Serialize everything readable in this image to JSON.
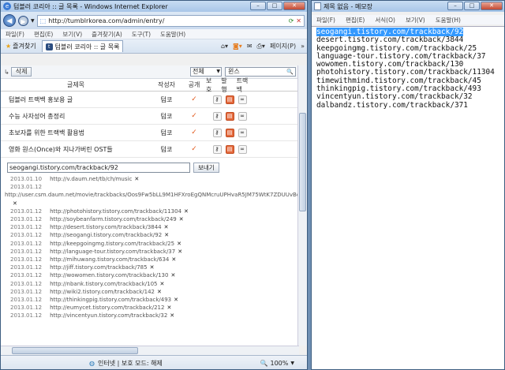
{
  "ie": {
    "title": "텀블러 코리아 :: 글 목록 - Windows Internet Explorer",
    "url": "http://tumblrkorea.com/admin/entry/",
    "menu": [
      "파일(F)",
      "편집(E)",
      "보기(V)",
      "즐겨찾기(A)",
      "도구(T)",
      "도움말(H)"
    ],
    "favorites_label": "즐겨찾기",
    "tab_label": "텀블러 코리아 :: 글 목록",
    "page_menu": "페이지(P)",
    "status_zone": "인터넷 | 보호 모드: 해제",
    "zoom": "100%"
  },
  "admin": {
    "delete_label": "삭제",
    "filter_select": "전체",
    "search_value": "윈스",
    "columns": {
      "title": "글제목",
      "author": "작성자",
      "public": "공개",
      "actions": [
        "보호",
        "발행",
        "트랙백"
      ]
    },
    "rows": [
      {
        "title": "텀블러 트랙백 홍보용 글",
        "author": "텀코"
      },
      {
        "title": "수능 사자성어 총정리",
        "author": "텀코"
      },
      {
        "title": "초보자를 위한 트랙백 활용법",
        "author": "텀코"
      },
      {
        "title": "영화 원스(Once)와 지나가버린 OST들",
        "author": "텀코"
      }
    ],
    "trackback_input": "seogangi.tistory.com/trackback/92",
    "send_label": "보내기",
    "trackbacks": [
      {
        "date": "2013.01.10",
        "url": "http://v.daum.net/tb/ch/music",
        "x": true
      },
      {
        "date": "2013.01.12",
        "url": "",
        "x": false
      },
      {
        "date": "",
        "url": "http://user.csm.daum.net/movie/trackbacks/Oos9Fw5bLL9M1HFXroEgQNMcruUPHvaR5JM75WtK7ZDUUvBdCwEE6cCa",
        "x": false,
        "full": true
      },
      {
        "date": "",
        "url": "",
        "x": true
      },
      {
        "date": "2013.01.12",
        "url": "http://photohistory.tistory.com/trackback/11304",
        "x": true
      },
      {
        "date": "2013.01.12",
        "url": "http://soybeanfarm.tistory.com/trackback/249",
        "x": true
      },
      {
        "date": "2013.01.12",
        "url": "http://desert.tistory.com/trackback/3844",
        "x": true
      },
      {
        "date": "2013.01.12",
        "url": "http://seogangi.tistory.com/trackback/92",
        "x": true
      },
      {
        "date": "2013.01.12",
        "url": "http://keepgoingmg.tistory.com/trackback/25",
        "x": true
      },
      {
        "date": "2013.01.12",
        "url": "http://language-tour.tistory.com/trackback/37",
        "x": true
      },
      {
        "date": "2013.01.12",
        "url": "http://mihuwang.tistory.com/trackback/634",
        "x": true
      },
      {
        "date": "2013.01.12",
        "url": "http://jiff.tistory.com/trackback/785",
        "x": true
      },
      {
        "date": "2013.01.12",
        "url": "http://wowomen.tistory.com/trackback/130",
        "x": true
      },
      {
        "date": "2013.01.12",
        "url": "http://nbank.tistory.com/trackback/105",
        "x": true
      },
      {
        "date": "2013.01.12",
        "url": "http://wiki2.tistory.com/trackback/142",
        "x": true
      },
      {
        "date": "2013.01.12",
        "url": "http://thinkingpig.tistory.com/trackback/493",
        "x": true
      },
      {
        "date": "2013.01.12",
        "url": "http://eumycet.tistory.com/trackback/212",
        "x": true
      },
      {
        "date": "2013.01.12",
        "url": "http://vincentyun.tistory.com/trackback/32",
        "x": true
      }
    ]
  },
  "notepad": {
    "title": "제목 없음 - 메모장",
    "menu": [
      "파일(F)",
      "편집(E)",
      "서식(O)",
      "보기(V)",
      "도움말(H)"
    ],
    "lines": [
      "seogangi.tistory.com/trackback/92",
      "desert.tistory.com/trackback/3844",
      "keepgoingmg.tistory.com/trackback/25",
      "language-tour.tistory.com/trackback/37",
      "wowomen.tistory.com/trackback/130",
      "photohistory.tistory.com/trackback/11304",
      "timewithmind.tistory.com/trackback/45",
      "thinkingpig.tistory.com/trackback/493",
      "vincentyun.tistory.com/trackback/32",
      "dalbandz.tistory.com/trackback/371"
    ]
  }
}
